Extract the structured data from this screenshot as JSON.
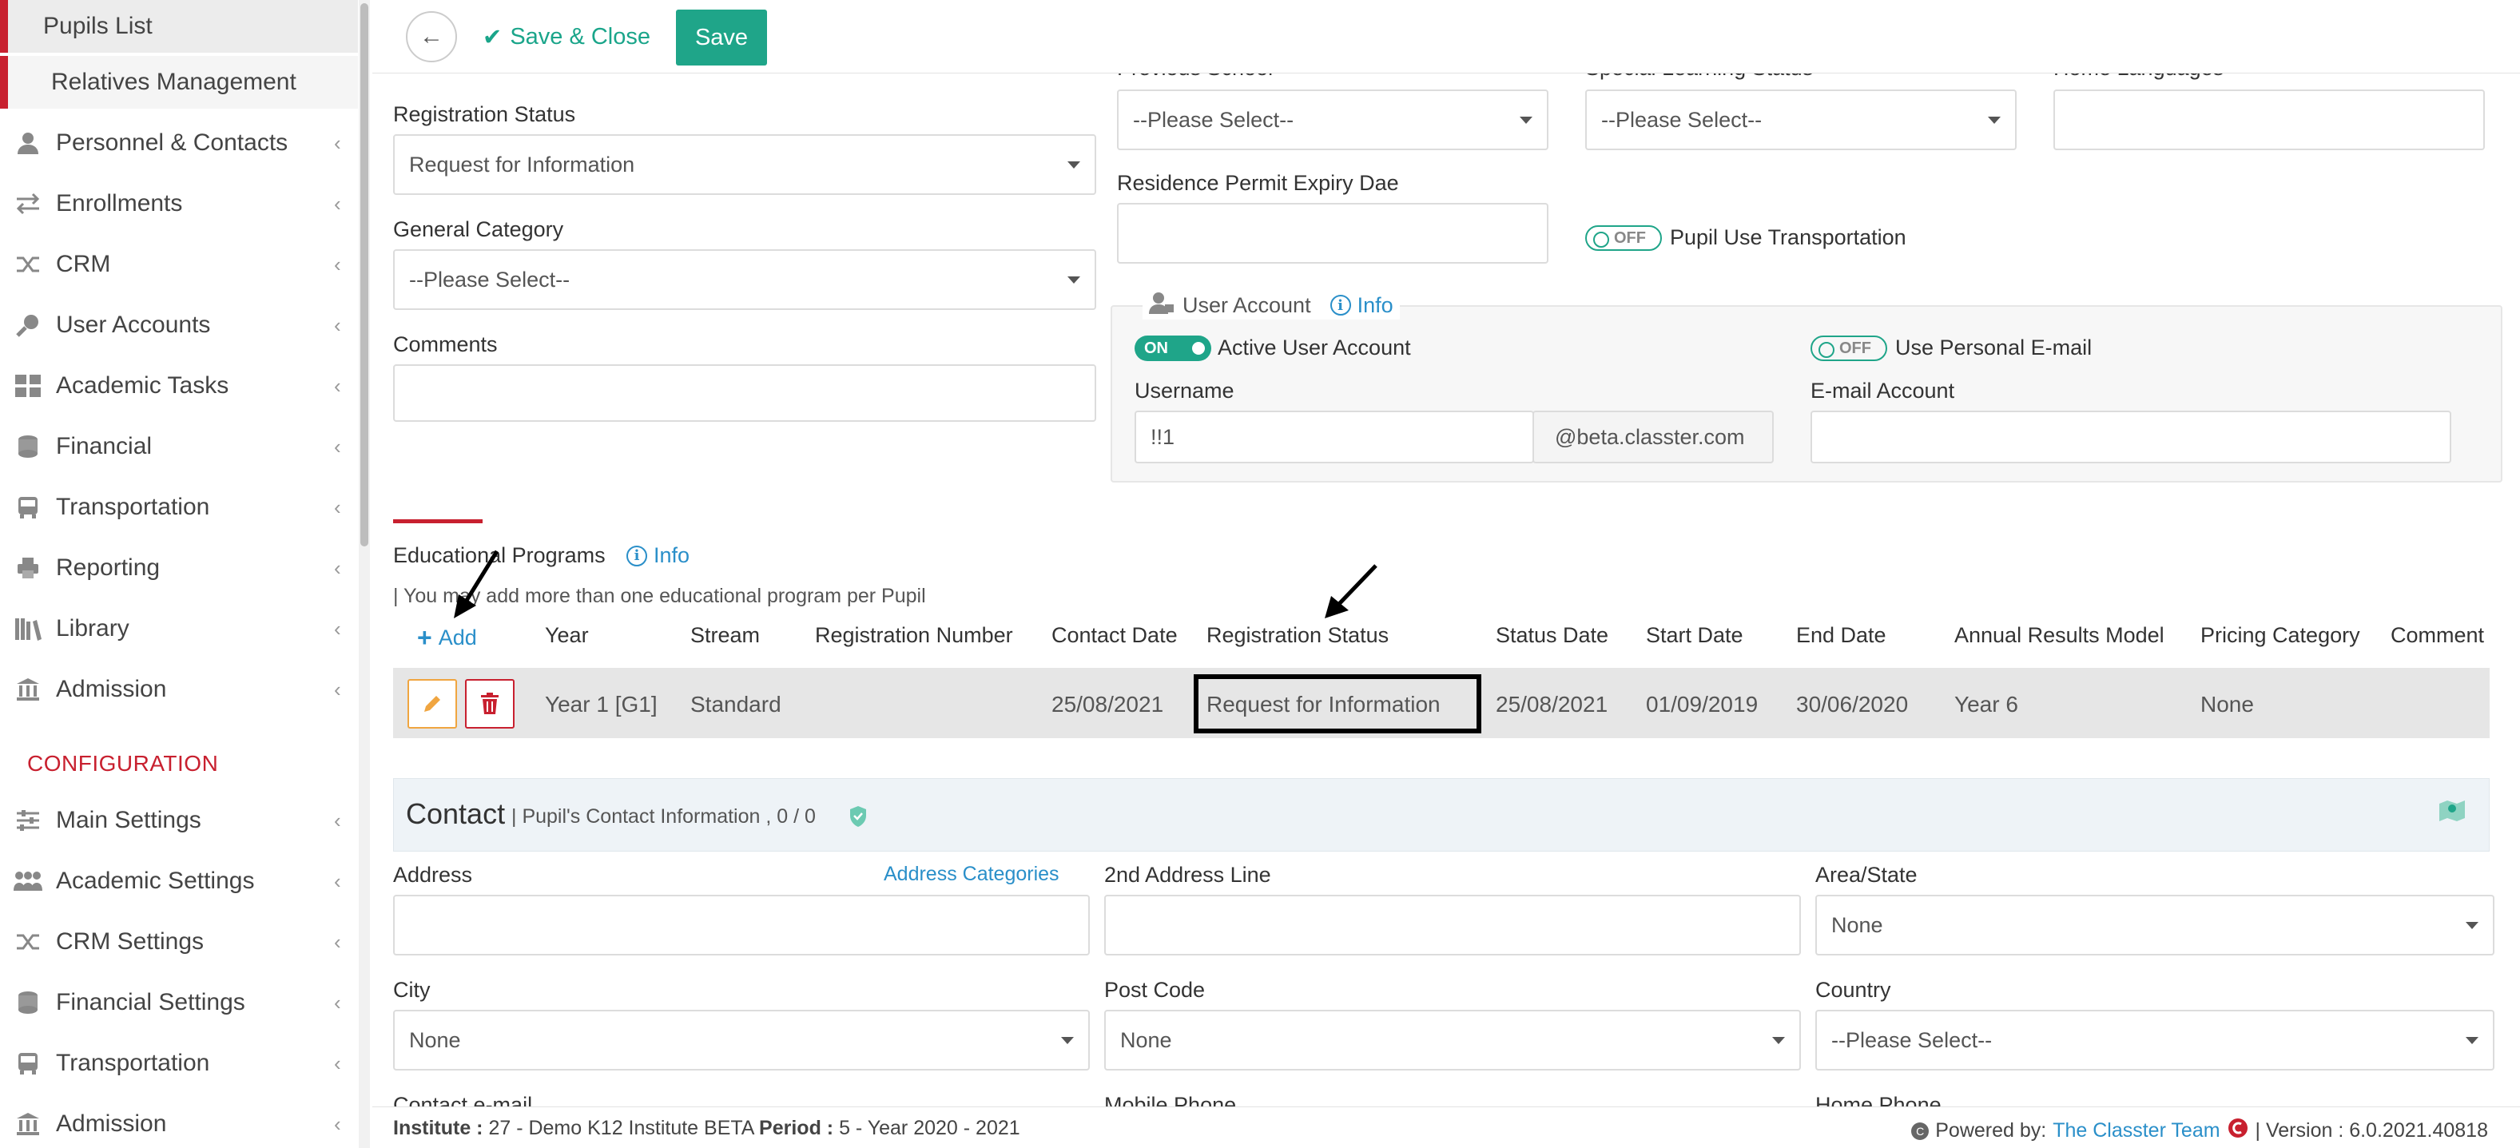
{
  "sidebar": {
    "sub_items": [
      {
        "label": "Pupils List",
        "active": true
      },
      {
        "label": "Relatives Management",
        "active": false
      }
    ],
    "items": [
      {
        "label": "Personnel & Contacts",
        "icon": "person-icon"
      },
      {
        "label": "Enrollments",
        "icon": "arrows-exchange-icon"
      },
      {
        "label": "CRM",
        "icon": "shuffle-icon"
      },
      {
        "label": "User Accounts",
        "icon": "key-icon"
      },
      {
        "label": "Academic Tasks",
        "icon": "grid-icon"
      },
      {
        "label": "Financial",
        "icon": "coins-icon"
      },
      {
        "label": "Transportation",
        "icon": "bus-icon"
      },
      {
        "label": "Reporting",
        "icon": "printer-icon"
      },
      {
        "label": "Library",
        "icon": "books-icon"
      },
      {
        "label": "Admission",
        "icon": "institution-icon"
      }
    ],
    "config_title": "CONFIGURATION",
    "config_items": [
      {
        "label": "Main Settings",
        "icon": "sliders-icon"
      },
      {
        "label": "Academic Settings",
        "icon": "users-group-icon"
      },
      {
        "label": "CRM Settings",
        "icon": "shuffle-icon"
      },
      {
        "label": "Financial Settings",
        "icon": "coins-icon"
      },
      {
        "label": "Transportation",
        "icon": "bus-icon"
      },
      {
        "label": "Admission",
        "icon": "institution-icon"
      }
    ]
  },
  "toolbar": {
    "save_close_label": "Save & Close",
    "save_label": "Save"
  },
  "form": {
    "previous_school_label": "Previous School",
    "previous_school_value": "--Please Select--",
    "special_learning_label": "Special Learning Status",
    "special_learning_value": "--Please Select--",
    "home_languages_label": "Home Languages",
    "registration_status_label": "Registration Status",
    "registration_status_value": "Request for Information",
    "residence_permit_label": "Residence Permit Expiry Dae",
    "general_category_label": "General Category",
    "general_category_value": "--Please Select--",
    "transport_toggle": "OFF",
    "transport_label": "Pupil Use Transportation",
    "comments_label": "Comments"
  },
  "user_account": {
    "title": "User Account",
    "info_label": "Info",
    "active_toggle": "ON",
    "active_label": "Active User Account",
    "personal_email_toggle": "OFF",
    "personal_email_label": "Use Personal E-mail",
    "username_label": "Username",
    "username_value": "!!1",
    "domain_suffix": "@beta.classter.com",
    "email_label": "E-mail Account"
  },
  "programs": {
    "title": "Educational Programs",
    "info_label": "Info",
    "note": "| You may add more than one educational program per Pupil",
    "add_label": "Add",
    "columns": [
      "Year",
      "Stream",
      "Registration Number",
      "Contact Date",
      "Registration Status",
      "Status Date",
      "Start Date",
      "End Date",
      "Annual Results Model",
      "Pricing Category",
      "Comment"
    ],
    "row": {
      "year": "Year 1 [G1]",
      "stream": "Standard",
      "registration_number": "",
      "contact_date": "25/08/2021",
      "registration_status": "Request for Information",
      "status_date": "25/08/2021",
      "start_date": "01/09/2019",
      "end_date": "30/06/2020",
      "annual_results_model": "Year 6",
      "pricing_category": "None",
      "comment": ""
    }
  },
  "contact": {
    "title": "Contact",
    "subtitle": "| Pupil's Contact Information , 0 / 0",
    "address_label": "Address",
    "address_categories_link": "Address Categories",
    "address2_label": "2nd Address Line",
    "area_label": "Area/State",
    "area_value": "None",
    "city_label": "City",
    "city_value": "None",
    "postcode_label": "Post Code",
    "postcode_value": "None",
    "country_label": "Country",
    "country_value": "--Please Select--",
    "contact_email_label": "Contact e-mail",
    "mobile_label": "Mobile Phone",
    "home_phone_label": "Home Phone"
  },
  "footer": {
    "institute_label": "Institute :",
    "institute_value": "27 - Demo K12 Institute BETA",
    "period_label": "Period :",
    "period_value": "5 - Year 2020 - 2021",
    "powered_by": "Powered by:",
    "team_link": "The Classter Team",
    "version": "| Version : 6.0.2021.40818"
  },
  "colors": {
    "accent_green": "#1fa589",
    "brand_red": "#c8202f",
    "link_blue": "#2a8fc9"
  }
}
